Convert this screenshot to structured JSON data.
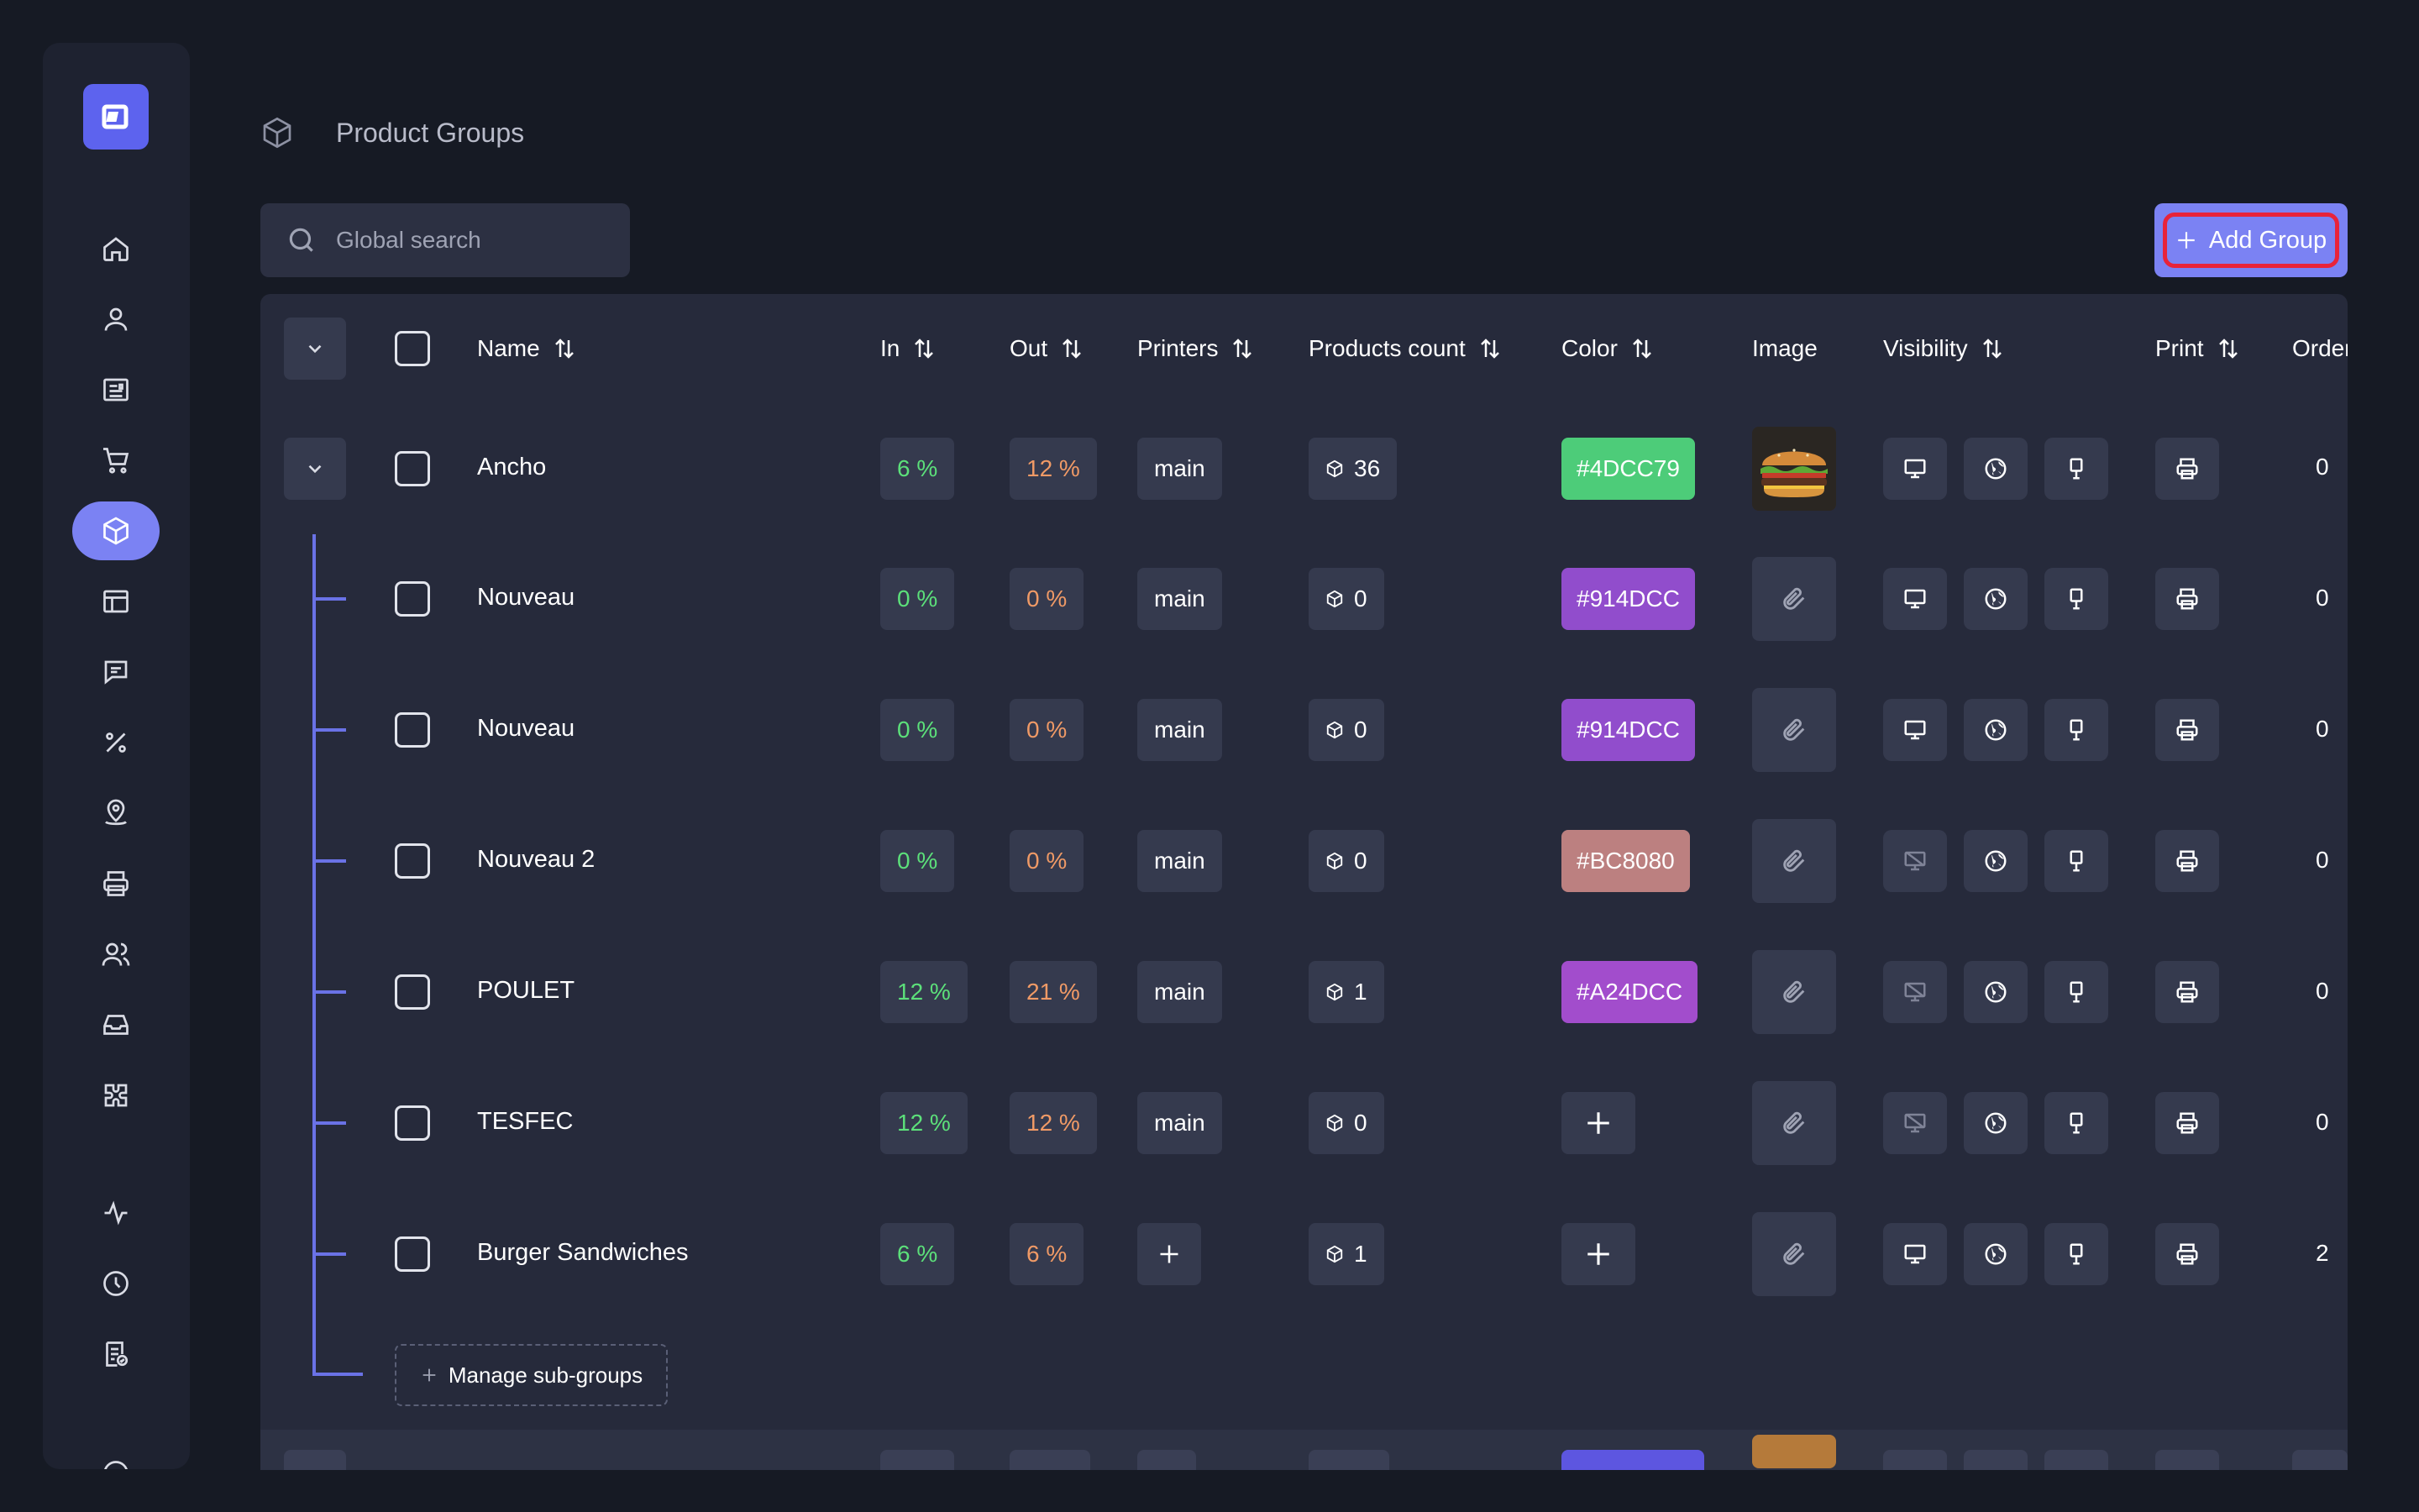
{
  "header": {
    "title": "Product Groups"
  },
  "search": {
    "placeholder": "Global search"
  },
  "toolbar": {
    "add_label": "Add Group"
  },
  "columns": {
    "name": "Name",
    "in": "In",
    "out": "Out",
    "printers": "Printers",
    "products_count": "Products count",
    "color": "Color",
    "image": "Image",
    "visibility": "Visibility",
    "print": "Print",
    "order": "Order"
  },
  "parent": {
    "name": "Ancho",
    "in": "6 %",
    "out": "12 %",
    "printer": "main",
    "count": "36",
    "color": "#4DCC79",
    "order": "0"
  },
  "rows": [
    {
      "name": "Nouveau",
      "in": "0 %",
      "out": "0 %",
      "printer": "main",
      "count": "0",
      "color": "#914DCC",
      "order": "0",
      "display_visible": true
    },
    {
      "name": "Nouveau",
      "in": "0 %",
      "out": "0 %",
      "printer": "main",
      "count": "0",
      "color": "#914DCC",
      "order": "0",
      "display_visible": true
    },
    {
      "name": "Nouveau 2",
      "in": "0 %",
      "out": "0 %",
      "printer": "main",
      "count": "0",
      "color": "#BC8080",
      "order": "0",
      "display_visible": false
    },
    {
      "name": "POULET",
      "in": "12 %",
      "out": "21 %",
      "printer": "main",
      "count": "1",
      "color": "#A24DCC",
      "order": "0",
      "display_visible": false
    },
    {
      "name": "TESFEC",
      "in": "12 %",
      "out": "12 %",
      "printer": "main",
      "count": "0",
      "color": null,
      "order": "0",
      "display_visible": false
    },
    {
      "name": "Burger Sandwiches",
      "in": "6 %",
      "out": "6 %",
      "printer": null,
      "count": "1",
      "color": null,
      "order": "2",
      "display_visible": true
    }
  ],
  "manage_subgroups": "Manage sub-groups",
  "icons": {
    "nav": [
      "home-icon",
      "user-icon",
      "orders-icon",
      "cart-icon",
      "product-groups-icon",
      "table-icon",
      "chat-icon",
      "percent-icon",
      "location-icon",
      "printer-icon",
      "users-icon",
      "inbox-icon",
      "integrations-icon",
      "activity-icon",
      "clock-icon",
      "report-icon"
    ],
    "visibility": [
      "monitor-icon",
      "globe-icon",
      "kiosk-icon"
    ]
  },
  "colors": {
    "accent": "#7B82F3",
    "in": "#5CE07A",
    "out": "#F09A66"
  }
}
